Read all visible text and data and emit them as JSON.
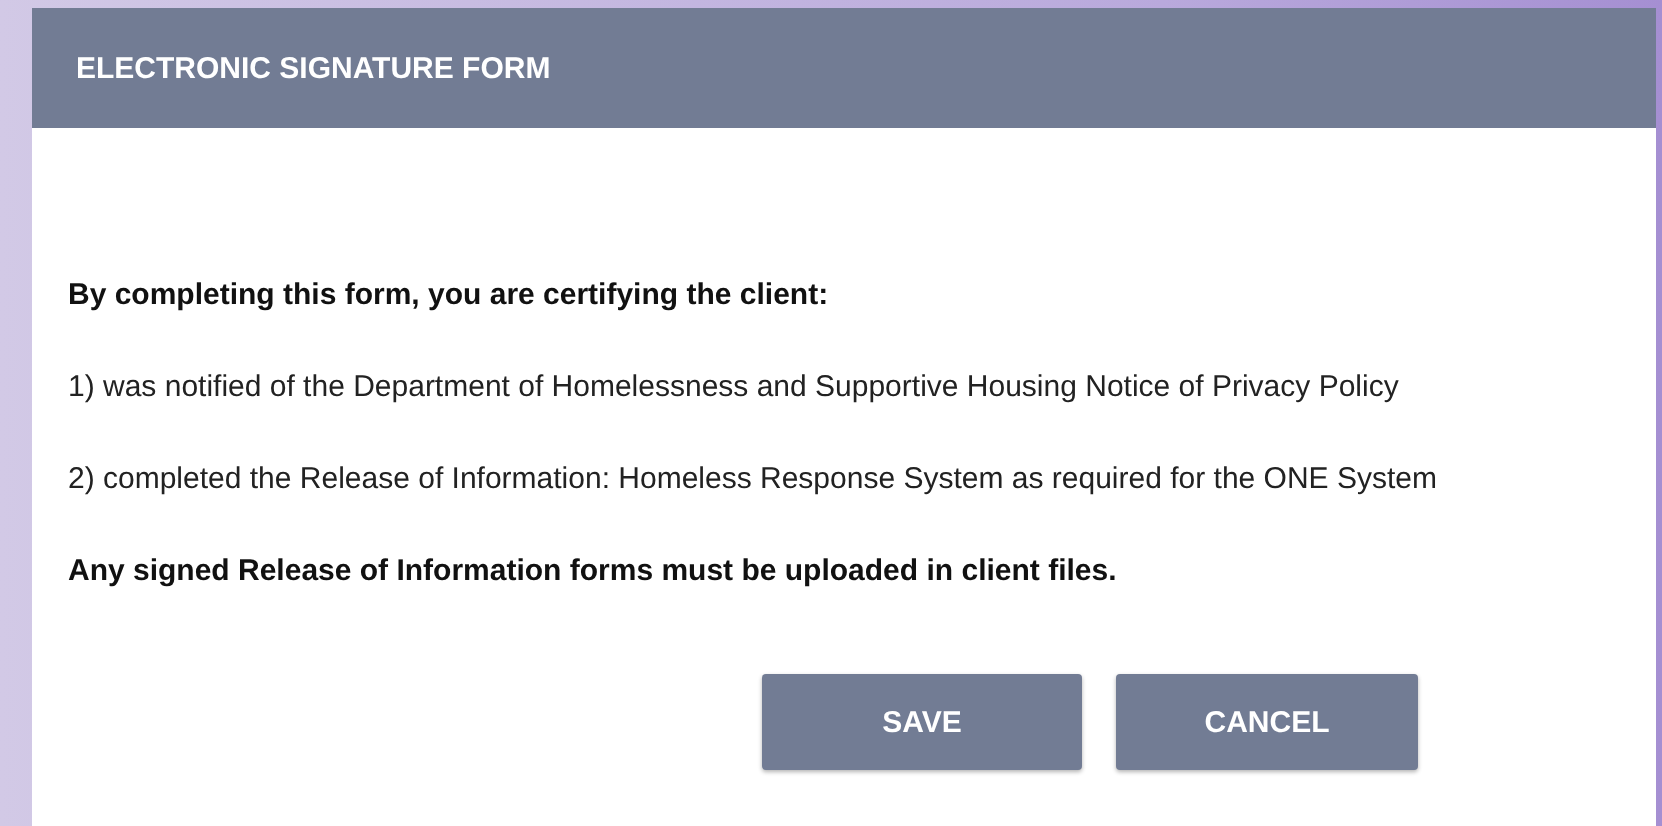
{
  "dialog": {
    "title": "ELECTRONIC SIGNATURE FORM",
    "paragraphs": [
      {
        "text": "By completing this form, you are certifying the client:",
        "bold": true
      },
      {
        "text": "1) was notified of the Department of Homelessness and Supportive Housing Notice of Privacy Policy",
        "bold": false
      },
      {
        "text": "2) completed the Release of Information: Homeless Response System as required for the ONE System",
        "bold": false
      },
      {
        "text": "Any signed Release of Information forms must be uploaded in client files.",
        "bold": true
      }
    ],
    "buttons": [
      "SAVE",
      "CANCEL"
    ]
  }
}
